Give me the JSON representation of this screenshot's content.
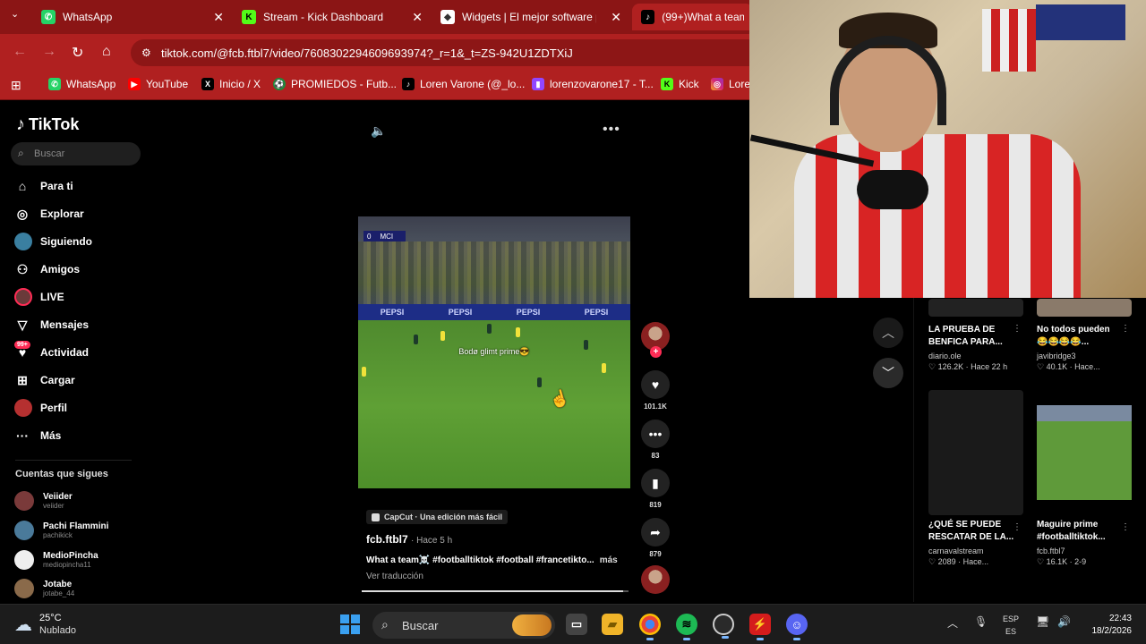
{
  "browser": {
    "tabs": [
      {
        "label": "WhatsApp",
        "icon": "whatsapp-icon",
        "color": "#25d366"
      },
      {
        "label": "Stream - Kick Dashboard",
        "icon": "kick-icon",
        "color": "#53fc18"
      },
      {
        "label": "Widgets | El mejor software par",
        "icon": "widgets-icon",
        "color": "#ffffff"
      },
      {
        "label": "(99+)What a team",
        "icon": "tiktok-icon",
        "color": "#000000"
      }
    ],
    "url": "tiktok.com/@fcb.ftbl7/video/7608302294609693974?_r=1&_t=ZS-942U1ZDTXiJ",
    "bookmarks": [
      {
        "label": "WhatsApp",
        "icon": "whatsapp-icon"
      },
      {
        "label": "YouTube",
        "icon": "youtube-icon"
      },
      {
        "label": "Inicio / X",
        "icon": "x-icon"
      },
      {
        "label": "PROMIEDOS - Futb...",
        "icon": "promiedos-icon"
      },
      {
        "label": "Loren Varone (@_lo...",
        "icon": "tiktok-icon"
      },
      {
        "label": "lorenzovarone17 - T...",
        "icon": "twitch-icon"
      },
      {
        "label": "Kick",
        "icon": "kick-icon"
      },
      {
        "label": "Lore",
        "icon": "instagram-icon"
      }
    ]
  },
  "tiktok": {
    "logo": "TikTok",
    "search_placeholder": "Buscar",
    "nav": [
      {
        "label": "Para ti",
        "icon": "home-icon"
      },
      {
        "label": "Explorar",
        "icon": "compass-icon"
      },
      {
        "label": "Siguiendo",
        "icon": "following-avatar"
      },
      {
        "label": "Amigos",
        "icon": "friends-icon"
      },
      {
        "label": "LIVE",
        "icon": "live-avatar"
      },
      {
        "label": "Mensajes",
        "icon": "paper-plane-icon"
      },
      {
        "label": "Actividad",
        "icon": "activity-icon",
        "badge": "99+"
      },
      {
        "label": "Cargar",
        "icon": "upload-icon"
      },
      {
        "label": "Perfil",
        "icon": "profile-avatar"
      },
      {
        "label": "Más",
        "icon": "more-icon"
      }
    ],
    "following_header": "Cuentas que sigues",
    "following": [
      {
        "name": "Veiider",
        "handle": "veiider"
      },
      {
        "name": "Pachi Flammini",
        "handle": "pachikick"
      },
      {
        "name": "MedioPincha",
        "handle": "mediopincha11"
      },
      {
        "name": "Jotabe",
        "handle": "jotabe_44"
      }
    ],
    "video": {
      "score_left": "0",
      "score_team": "MCI",
      "overlay_text": "Bodø glimt prime😎",
      "board_text": "PEPSI",
      "capcut_label": "CapCut · Una edición más fácil",
      "author": "fcb.ftbl7",
      "time_ago": "· Hace 5 h",
      "description": "What a team☠️ #footballtiktok #football #francetikto...",
      "more": "más",
      "translate": "Ver traducción",
      "progress": 0.98
    },
    "actions": {
      "likes": "101.1K",
      "comments": "83",
      "saves": "819",
      "shares": "879"
    }
  },
  "recommendations": [
    {
      "title": "LA PRUEBA DE BENFICA PARA...",
      "user": "diario.ole",
      "likes": "126.2K",
      "ago": "Hace 22 h"
    },
    {
      "title": "No todos pueden 😂😂😂😂...",
      "user": "javibridge3",
      "likes": "40.1K",
      "ago": "Hace..."
    },
    {
      "title": "¿QUÉ SE PUEDE RESCATAR DE LA...",
      "user": "carnavalstream",
      "likes": "2089",
      "ago": "Hace..."
    },
    {
      "title": "Maguire prime #footballtiktok...",
      "user": "fcb.ftbl7",
      "likes": "16.1K",
      "ago": "2-9"
    }
  ],
  "taskbar": {
    "temp": "25°C",
    "condition": "Nublado",
    "search_label": "Buscar",
    "lang1": "ESP",
    "lang2": "ES",
    "time": "22:43",
    "date": "18/2/2026"
  }
}
